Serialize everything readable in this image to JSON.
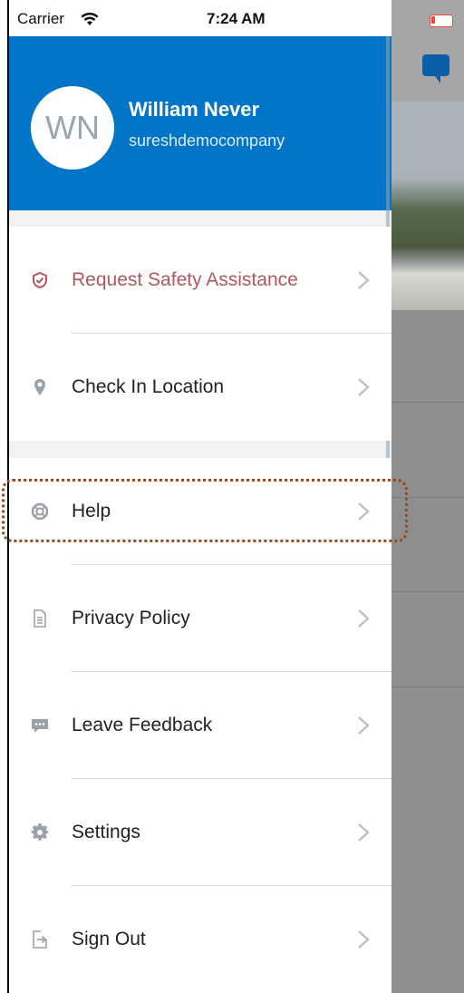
{
  "status_bar": {
    "carrier": "Carrier",
    "time": "7:24 AM"
  },
  "profile": {
    "initials": "WN",
    "name": "William Never",
    "company": "sureshdemocompany"
  },
  "menu": {
    "safety": {
      "label": "Request Safety Assistance",
      "icon": "shield-check-icon"
    },
    "check_in": {
      "label": "Check In Location",
      "icon": "location-pin-icon"
    },
    "help": {
      "label": "Help",
      "icon": "lifebuoy-icon"
    },
    "privacy": {
      "label": "Privacy Policy",
      "icon": "document-icon"
    },
    "feedback": {
      "label": "Leave Feedback",
      "icon": "chat-bubble-icon"
    },
    "settings": {
      "label": "Settings",
      "icon": "gear-icon"
    },
    "sign_out": {
      "label": "Sign Out",
      "icon": "sign-out-icon"
    }
  },
  "colors": {
    "header": "#0275c9",
    "danger": "#b2575f",
    "highlight": "#9a4b19"
  }
}
